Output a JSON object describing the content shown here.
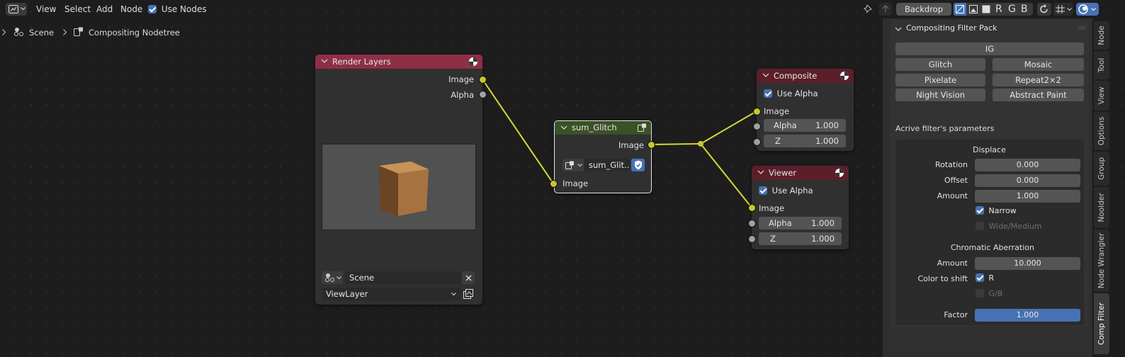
{
  "header": {
    "menu": {
      "view": "View",
      "select": "Select",
      "add": "Add",
      "node": "Node"
    },
    "use_nodes": {
      "label": "Use Nodes",
      "checked": true
    },
    "backdrop_label": "Backdrop",
    "channels": {
      "r": "R",
      "g": "G",
      "b": "B"
    }
  },
  "breadcrumb": {
    "scene": "Scene",
    "nodetree": "Compositing Nodetree"
  },
  "nodes": {
    "render_layers": {
      "title": "Render Layers",
      "outputs": {
        "image": "Image",
        "alpha": "Alpha"
      },
      "scene": "Scene",
      "view_layer": "ViewLayer",
      "header_color": "#8e2f45"
    },
    "sum_glitch": {
      "title": "sum_Glitch",
      "output": "Image",
      "input": "Image",
      "group_name": "sum_Glit...",
      "header_color": "#3b5126"
    },
    "composite": {
      "title": "Composite",
      "use_alpha": "Use Alpha",
      "image": "Image",
      "alpha_label": "Alpha",
      "alpha_value": "1.000",
      "z_label": "Z",
      "z_value": "1.000",
      "header_color": "#5c1f2a"
    },
    "viewer": {
      "title": "Viewer",
      "use_alpha": "Use Alpha",
      "image": "Image",
      "alpha_label": "Alpha",
      "alpha_value": "1.000",
      "z_label": "Z",
      "z_value": "1.000",
      "header_color": "#5c1f2a"
    }
  },
  "panel": {
    "title": "Compositing Filter Pack",
    "filters": [
      "IG",
      "Glitch",
      "Mosaic",
      "Pixelate",
      "Repeat2×2",
      "Night Vision",
      "Abstract Paint"
    ],
    "params_title": "Acrive filter's parameters",
    "displace": {
      "title": "Displace",
      "rotation_label": "Rotation",
      "rotation": "0.000",
      "offset_label": "Offset",
      "offset": "0.000",
      "amount_label": "Amount",
      "amount": "1.000",
      "narrow": "Narrow",
      "wide": "Wide/Medium"
    },
    "chromatic": {
      "title": "Chromatic Aberration",
      "amount_label": "Amount",
      "amount": "10.000",
      "shift_label": "Color to shift",
      "r": "R",
      "gb": "G/B"
    },
    "factor_label": "Factor",
    "factor": "1.000",
    "factor_color": "#4772b3"
  },
  "tabs": [
    "Node",
    "Tool",
    "View",
    "Options",
    "Group",
    "Noolder",
    "Node Wrangler",
    "Comp Filter"
  ],
  "active_tab": "Comp Filter",
  "colors": {
    "socket_image": "#c7c729",
    "socket_value": "#a1a1a1",
    "accent": "#4772b3"
  }
}
